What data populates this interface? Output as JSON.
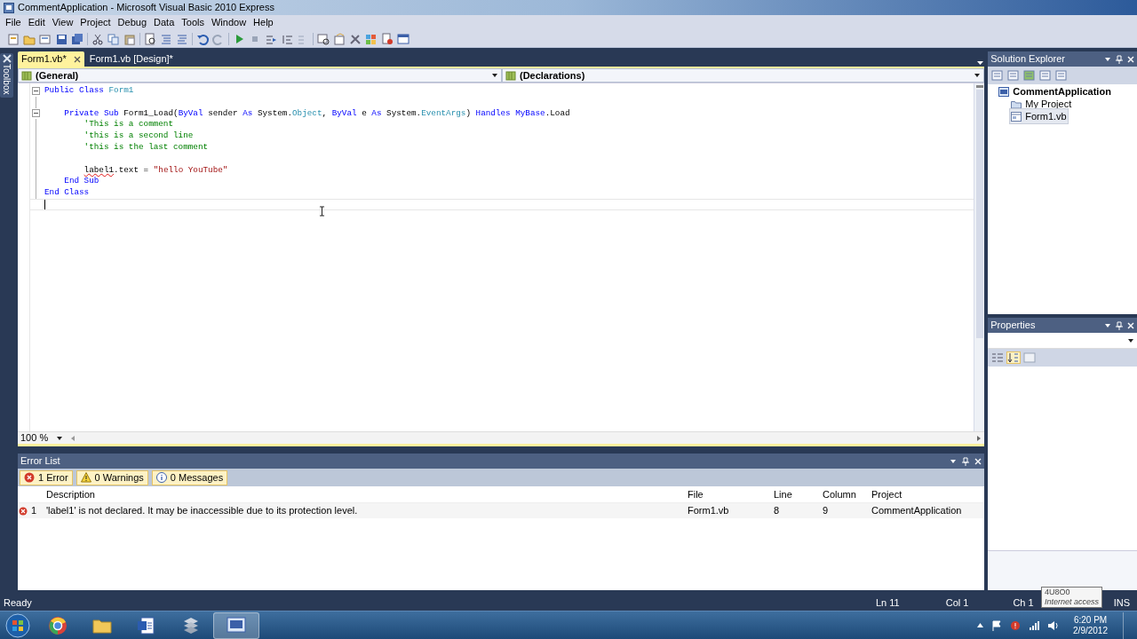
{
  "window": {
    "title": "CommentApplication - Microsoft Visual Basic 2010 Express"
  },
  "menu": [
    "File",
    "Edit",
    "View",
    "Project",
    "Debug",
    "Data",
    "Tools",
    "Window",
    "Help"
  ],
  "toolbox_tab": {
    "label": "Toolbox"
  },
  "document_tabs": [
    {
      "label": "Form1.vb*",
      "selected": true
    },
    {
      "label": "Form1.vb [Design]*",
      "selected": false
    }
  ],
  "editor": {
    "class_dropdown": "(General)",
    "member_dropdown": "(Declarations)",
    "zoom": "100 %",
    "lines": [
      {
        "foldable": true,
        "current": false,
        "segments": [
          {
            "t": "Public Class ",
            "kind": "keyword"
          },
          {
            "t": "Form1",
            "kind": "type"
          }
        ]
      },
      {
        "foldable": false,
        "current": false
      },
      {
        "foldable": true,
        "current": false,
        "segments": [
          {
            "t": "    Private Sub ",
            "kind": "keyword"
          },
          {
            "t": "Form1_Load(",
            "kind": "plain"
          },
          {
            "t": "ByVal",
            "kind": "keyword"
          },
          {
            "t": " sender ",
            "kind": "plain"
          },
          {
            "t": "As",
            "kind": "keyword"
          },
          {
            "t": " System.",
            "kind": "plain"
          },
          {
            "t": "Object",
            "kind": "type"
          },
          {
            "t": ", ",
            "kind": "plain"
          },
          {
            "t": "ByVal",
            "kind": "keyword"
          },
          {
            "t": " e ",
            "kind": "plain"
          },
          {
            "t": "As",
            "kind": "keyword"
          },
          {
            "t": " System.",
            "kind": "plain"
          },
          {
            "t": "EventArgs",
            "kind": "type"
          },
          {
            "t": ") ",
            "kind": "plain"
          },
          {
            "t": "Handles ",
            "kind": "keyword"
          },
          {
            "t": "MyBase",
            "kind": "keyword"
          },
          {
            "t": ".Load",
            "kind": "plain"
          }
        ]
      },
      {
        "foldable": false,
        "current": false,
        "segments": [
          {
            "t": "        'This is a comment",
            "kind": "comment"
          }
        ]
      },
      {
        "foldable": false,
        "current": false,
        "segments": [
          {
            "t": "        'this is a second line",
            "kind": "comment"
          }
        ]
      },
      {
        "foldable": false,
        "current": false,
        "segments": [
          {
            "t": "        'this is the last comment",
            "kind": "comment"
          }
        ]
      },
      {
        "foldable": false,
        "current": false
      },
      {
        "foldable": false,
        "current": false,
        "segments": [
          {
            "t": "        label1",
            "kind": "error"
          },
          {
            "t": ".text = ",
            "kind": "plain"
          },
          {
            "t": "\"hello YouTube\"",
            "kind": "string"
          }
        ]
      },
      {
        "foldable": false,
        "current": false,
        "segments": [
          {
            "t": "    End Sub",
            "kind": "keyword"
          }
        ]
      },
      {
        "foldable": false,
        "current": false,
        "segments": [
          {
            "t": "End Class",
            "kind": "keyword"
          }
        ]
      },
      {
        "foldable": false,
        "current": true
      }
    ]
  },
  "error_list": {
    "title": "Error List",
    "filters": [
      {
        "kind": "error",
        "label": "1 Error"
      },
      {
        "kind": "warning",
        "label": "0 Warnings"
      },
      {
        "kind": "info",
        "label": "0 Messages"
      }
    ],
    "columns": [
      "Description",
      "File",
      "Line",
      "Column",
      "Project"
    ],
    "rows": [
      {
        "number": "1",
        "description": "'label1' is not declared. It may be inaccessible due to its protection level.",
        "file": "Form1.vb",
        "line": "8",
        "column": "9",
        "project": "CommentApplication"
      }
    ]
  },
  "solution_explorer": {
    "title": "Solution Explorer",
    "tree": [
      {
        "label": "CommentApplication",
        "kind": "solution",
        "selected": false,
        "children": [
          {
            "label": "My Project",
            "kind": "properties",
            "selected": false
          },
          {
            "label": "Form1.vb",
            "kind": "form",
            "selected": true
          }
        ]
      }
    ]
  },
  "properties": {
    "title": "Properties"
  },
  "status_bar": {
    "status": "Ready",
    "line": "Ln 11",
    "column": "Col 1",
    "char": "Ch 1",
    "mode": "INS"
  },
  "tooltip": {
    "title": "4U8O0",
    "text": "Internet access"
  },
  "taskbar": {
    "time": "6:20 PM",
    "date": "2/9/2012"
  }
}
